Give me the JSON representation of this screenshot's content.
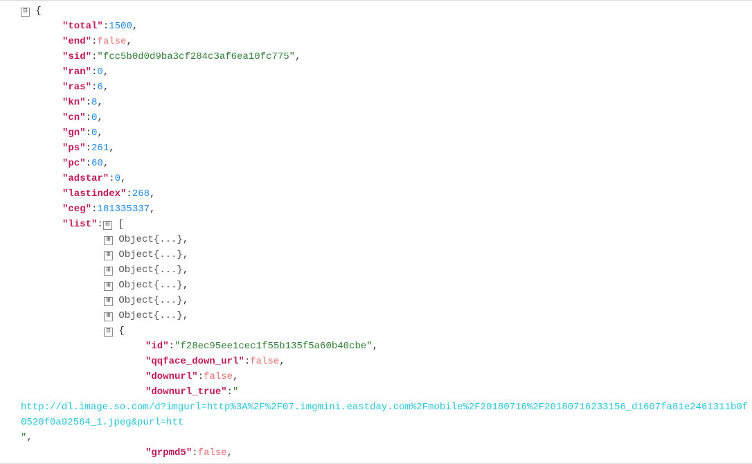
{
  "root": {
    "total": 1500,
    "end": false,
    "sid": "fcc5b0d0d9ba3cf284c3af6ea10fc775",
    "ran": 0,
    "ras": 6,
    "kn": 8,
    "cn": 0,
    "gn": 0,
    "ps": 261,
    "pc": 60,
    "adstar": 0,
    "lastindex": 268,
    "ceg": 181335337,
    "list_label": "list",
    "collapsed_object_label": "Object{...}",
    "collapsed_count": 6,
    "expanded_item": {
      "id": "f28ec95ee1cec1f55b135f5a60b40cbe",
      "qqface_down_url_key": "qqface_down_url",
      "qqface_down_url": false,
      "downurl_key": "downurl",
      "downurl": false,
      "downurl_true_key": "downurl_true",
      "downurl_true": "http://dl.image.so.com/d?imgurl=http%3A%2F%2F07.imgmini.eastday.com%2Fmobile%2F20180716%2F20180716233156_d1607fa81e2461311b0f0520f0a92564_1.jpeg&purl=htt",
      "grpmd5_key": "grpmd5",
      "grpmd5": false
    }
  },
  "glyphs": {
    "minus": "⊟",
    "plus": "⊞",
    "quote": "\""
  },
  "indent": {
    "l1": 90,
    "l2": 150,
    "l3": 210
  }
}
